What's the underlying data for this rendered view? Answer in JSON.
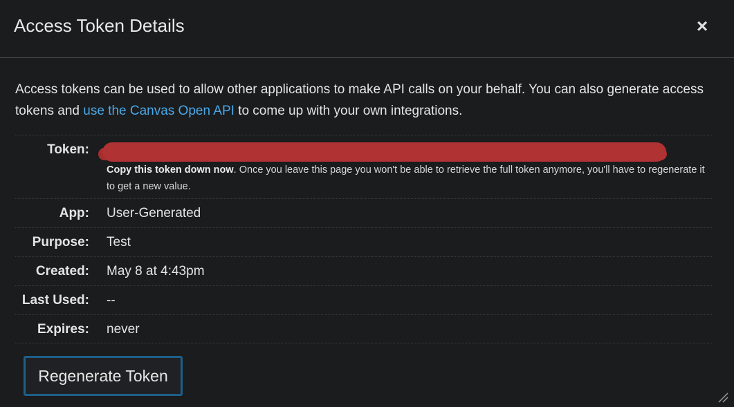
{
  "dialog": {
    "title": "Access Token Details",
    "close_label": "×"
  },
  "intro": {
    "text_before": "Access tokens can be used to allow other applications to make API calls on your behalf. You can also generate access tokens and ",
    "link_text": "use the Canvas Open API",
    "text_after": " to come up with your own integrations."
  },
  "details": {
    "token": {
      "label": "Token:",
      "note_bold": "Copy this token down now",
      "note_rest": ". Once you leave this page you won't be able to retrieve the full token anymore, you'll have to regenerate it to get a new value."
    },
    "app": {
      "label": "App:",
      "value": "User-Generated"
    },
    "purpose": {
      "label": "Purpose:",
      "value": "Test"
    },
    "created": {
      "label": "Created:",
      "value": "May 8 at 4:43pm"
    },
    "last_used": {
      "label": "Last Used:",
      "value": "--"
    },
    "expires": {
      "label": "Expires:",
      "value": "never"
    }
  },
  "actions": {
    "regenerate_label": "Regenerate Token"
  },
  "colors": {
    "background": "#1b1c1e",
    "link": "#4aa8e8",
    "redaction": "#b03232",
    "button_border": "#1d5f8a"
  },
  "icons": {
    "close": "close-icon",
    "resize": "resize-handle-icon"
  }
}
